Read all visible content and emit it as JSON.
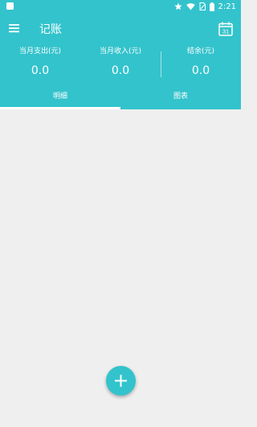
{
  "status_bar": {
    "time": "2:21",
    "icons": [
      "notification-square-icon",
      "star-icon",
      "wifi-icon",
      "sim-icon",
      "battery-icon"
    ]
  },
  "toolbar": {
    "title": "记账",
    "menu_icon": "menu-icon",
    "calendar_icon": "calendar-icon",
    "calendar_day": "31"
  },
  "stats": {
    "expense_label": "当月支出(元)",
    "expense_value": "0.0",
    "income_label": "当月收入(元)",
    "income_value": "0.0",
    "balance_label": "结余(元)",
    "balance_value": "0.0"
  },
  "tabs": [
    {
      "label": "明细",
      "selected": true
    },
    {
      "label": "图表",
      "selected": false
    }
  ],
  "fab": {
    "icon": "plus-icon"
  },
  "colors": {
    "accent": "#33c3cc",
    "background": "#efefef",
    "on_accent": "#ffffff"
  }
}
